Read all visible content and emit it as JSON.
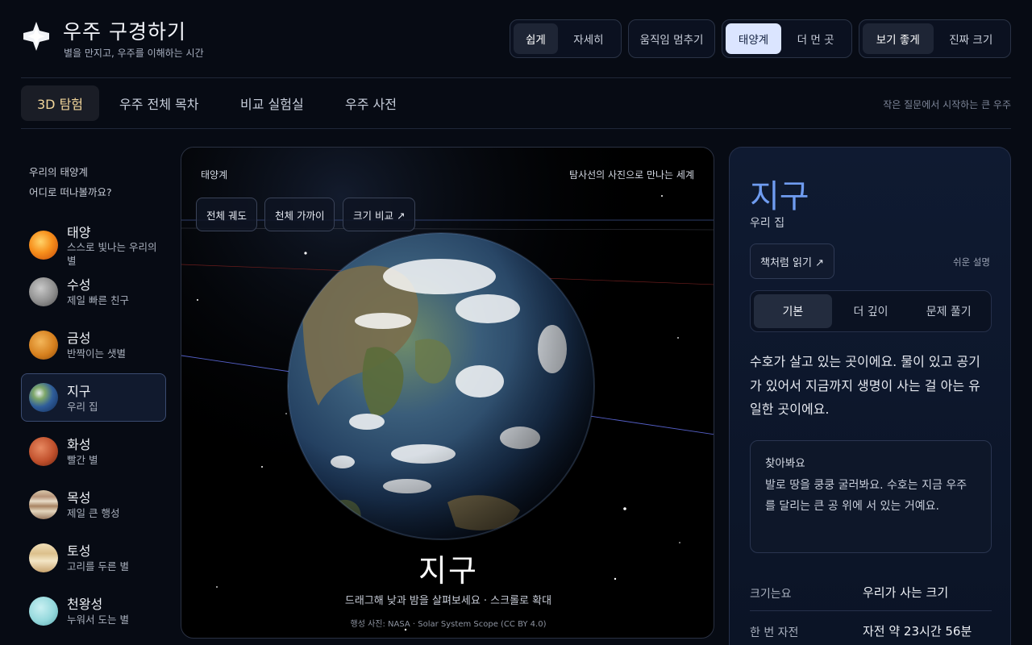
{
  "app": {
    "title": "우주 구경하기",
    "subtitle": "별을 만지고, 우주를 이해하는 시간"
  },
  "toggles": {
    "level": [
      "쉽게",
      "자세히"
    ],
    "motion": "움직임 멈추기",
    "scope": [
      "태양계",
      "더 먼 곳"
    ],
    "scale": [
      "보기 좋게",
      "진짜 크기"
    ]
  },
  "nav": {
    "tabs": [
      "3D 탐험",
      "우주 전체 목차",
      "비교 실험실",
      "우주 사전"
    ],
    "tagline": "작은 질문에서 시작하는 큰 우주"
  },
  "sidebar": {
    "title": "우리의 태양계",
    "subtitle": "어디로 떠나볼까요?",
    "planets": [
      {
        "name": "태양",
        "desc": "스스로 빛나는 우리의 별"
      },
      {
        "name": "수성",
        "desc": "제일 빠른 친구"
      },
      {
        "name": "금성",
        "desc": "반짝이는 샛별"
      },
      {
        "name": "지구",
        "desc": "우리 집"
      },
      {
        "name": "화성",
        "desc": "빨간 별"
      },
      {
        "name": "목성",
        "desc": "제일 큰 행성"
      },
      {
        "name": "토성",
        "desc": "고리를 두른 별"
      },
      {
        "name": "천왕성",
        "desc": "누워서 도는 별"
      }
    ]
  },
  "viewer": {
    "label": "태양계",
    "note": "탐사선의 사진으로 만나는 세계",
    "buttons": [
      "전체 궤도",
      "천체 가까이",
      "크기 비교 ↗"
    ],
    "planet_name": "지구",
    "hint": "드래그해 낮과 밤을 살펴보세요 · 스크롤로 확대",
    "credit": "행성 사진: NASA · Solar System Scope (CC BY 4.0)"
  },
  "info": {
    "title": "지구",
    "subtitle": "우리 집",
    "read_button": "책처럼 읽기 ↗",
    "mode_label": "쉬운 설명",
    "tabs": [
      "기본",
      "더 깊이",
      "문제 풀기"
    ],
    "body": "수호가 살고 있는 곳이에요. 물이 있고 공기가 있어서 지금까지 생명이 사는 걸 아는 유일한 곳이에요.",
    "find_title": "찾아봐요",
    "find_text": "발로 땅을 쿵쿵 굴러봐요. 수호는 지금 우주를 달리는 큰 공 위에 서 있는 거예요.",
    "facts": [
      {
        "label": "크기는요",
        "value": "우리가 사는 크기"
      },
      {
        "label": "한 번 자전",
        "value": "자전 약 23시간 56분"
      }
    ]
  },
  "colors": {
    "background": "#070b14",
    "accent_title": "#6f9cf0",
    "active_tab_text": "#f1d59a",
    "active_scope": "#dbe5ff"
  }
}
